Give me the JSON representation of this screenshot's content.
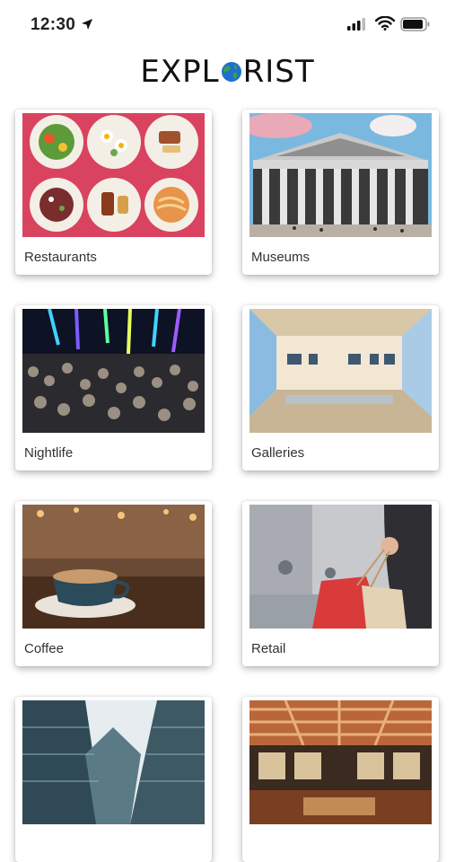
{
  "status_bar": {
    "time": "12:30"
  },
  "app": {
    "logo_left": "EXPL",
    "logo_right": "RIST"
  },
  "categories": [
    {
      "label": "Restaurants"
    },
    {
      "label": "Museums"
    },
    {
      "label": "Nightlife"
    },
    {
      "label": "Galleries"
    },
    {
      "label": "Coffee"
    },
    {
      "label": "Retail"
    },
    {
      "label": ""
    },
    {
      "label": ""
    }
  ],
  "colors": {
    "brand_text": "#111111",
    "globe_blue": "#1e6fd0",
    "globe_green": "#3aa04a"
  }
}
